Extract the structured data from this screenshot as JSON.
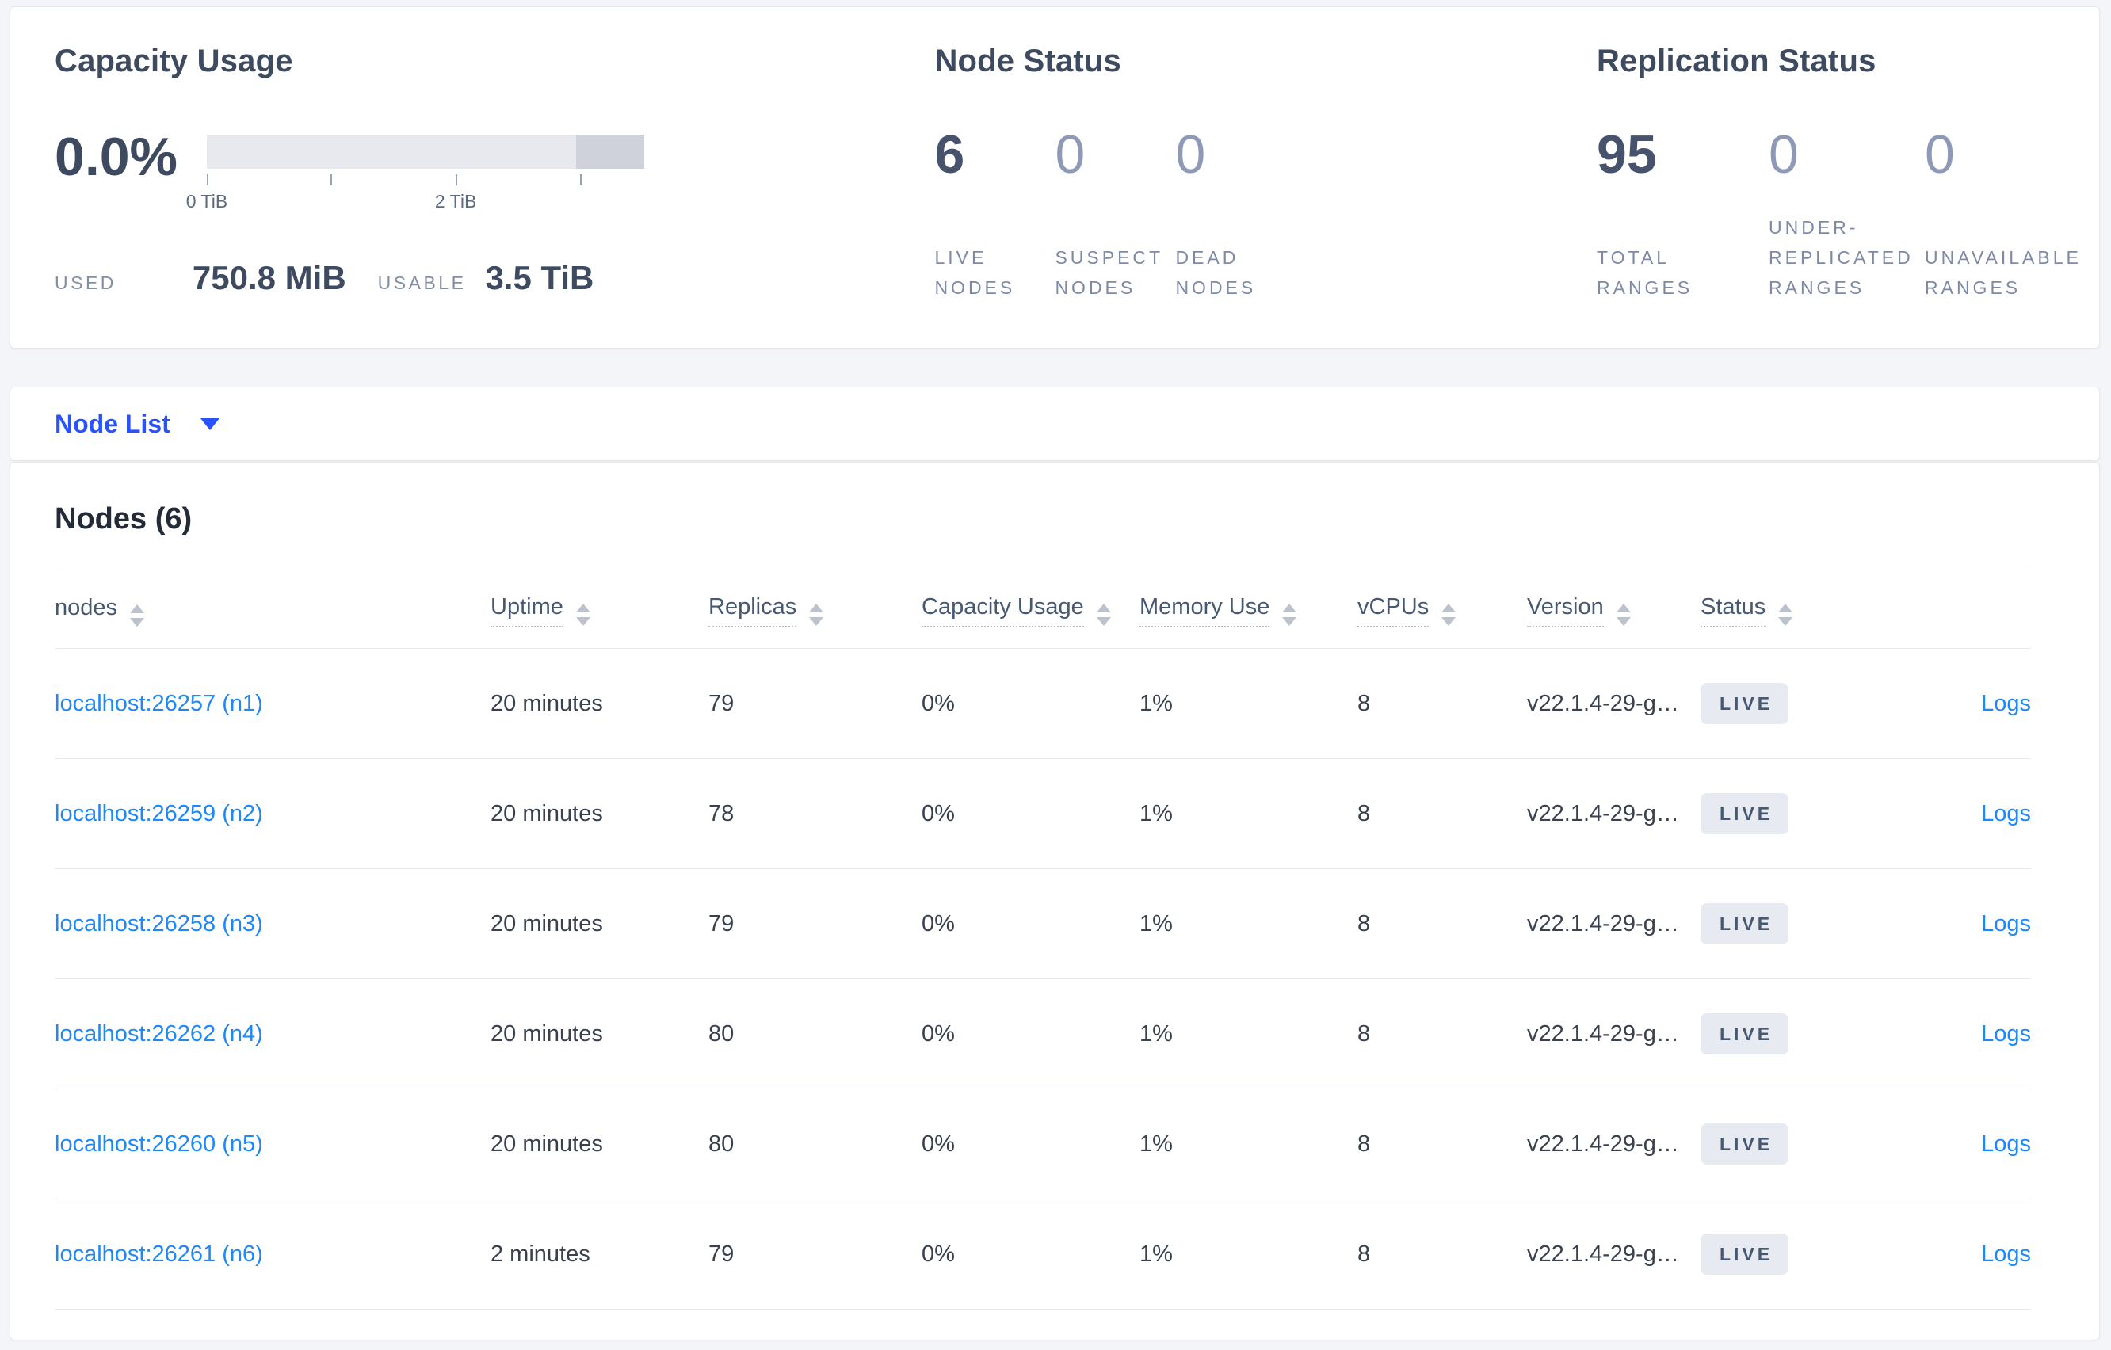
{
  "colors": {
    "page_bg": "#f4f5f9",
    "link_blue": "#1e88f7",
    "primary_blue": "#2952ff",
    "badge_bg": "#e7eaf1",
    "badge_text": "#475872",
    "bar_light": "#e8e9ee",
    "bar_dark": "#cfd2db",
    "dark_slate": "#3e4a5f",
    "muted_number": "#8e99b8"
  },
  "capacity": {
    "title": "Capacity Usage",
    "percent": "0.0%",
    "bar": {
      "usable_fraction_light": 0.845,
      "other_fraction_dark": 0.155
    },
    "tick_positions_pct": [
      0,
      28.3,
      56.9,
      85.3
    ],
    "tick_labels": {
      "first": "0 TiB",
      "third": "2 TiB"
    },
    "used_label": "USED",
    "used_value": "750.8 MiB",
    "usable_label": "USABLE",
    "usable_value": "3.5 TiB"
  },
  "node_status": {
    "title": "Node Status",
    "stats": [
      {
        "value": "6",
        "label": "LIVE NODES"
      },
      {
        "value": "0",
        "label": "SUSPECT NODES"
      },
      {
        "value": "0",
        "label": "DEAD NODES"
      }
    ]
  },
  "replication_status": {
    "title": "Replication Status",
    "stats": [
      {
        "value": "95",
        "label": "TOTAL RANGES"
      },
      {
        "value": "0",
        "label": "UNDER-REPLICATED RANGES"
      },
      {
        "value": "0",
        "label": "UNAVAILABLE RANGES"
      }
    ]
  },
  "node_list": {
    "label": "Node List"
  },
  "nodes_table": {
    "title": "Nodes (6)",
    "columns": [
      "nodes",
      "Uptime",
      "Replicas",
      "Capacity Usage",
      "Memory Use",
      "vCPUs",
      "Version",
      "Status"
    ],
    "logs_label": "Logs",
    "rows": [
      {
        "node": "localhost:26257 (n1)",
        "uptime": "20 minutes",
        "replicas": "79",
        "capacity": "0%",
        "memory": "1%",
        "vcpus": "8",
        "version": "v22.1.4-29-g…",
        "status": "LIVE",
        "logs": "Logs"
      },
      {
        "node": "localhost:26259 (n2)",
        "uptime": "20 minutes",
        "replicas": "78",
        "capacity": "0%",
        "memory": "1%",
        "vcpus": "8",
        "version": "v22.1.4-29-g…",
        "status": "LIVE",
        "logs": "Logs"
      },
      {
        "node": "localhost:26258 (n3)",
        "uptime": "20 minutes",
        "replicas": "79",
        "capacity": "0%",
        "memory": "1%",
        "vcpus": "8",
        "version": "v22.1.4-29-g…",
        "status": "LIVE",
        "logs": "Logs"
      },
      {
        "node": "localhost:26262 (n4)",
        "uptime": "20 minutes",
        "replicas": "80",
        "capacity": "0%",
        "memory": "1%",
        "vcpus": "8",
        "version": "v22.1.4-29-g…",
        "status": "LIVE",
        "logs": "Logs"
      },
      {
        "node": "localhost:26260 (n5)",
        "uptime": "20 minutes",
        "replicas": "80",
        "capacity": "0%",
        "memory": "1%",
        "vcpus": "8",
        "version": "v22.1.4-29-g…",
        "status": "LIVE",
        "logs": "Logs"
      },
      {
        "node": "localhost:26261 (n6)",
        "uptime": "2 minutes",
        "replicas": "79",
        "capacity": "0%",
        "memory": "1%",
        "vcpus": "8",
        "version": "v22.1.4-29-g…",
        "status": "LIVE",
        "logs": "Logs"
      }
    ]
  }
}
